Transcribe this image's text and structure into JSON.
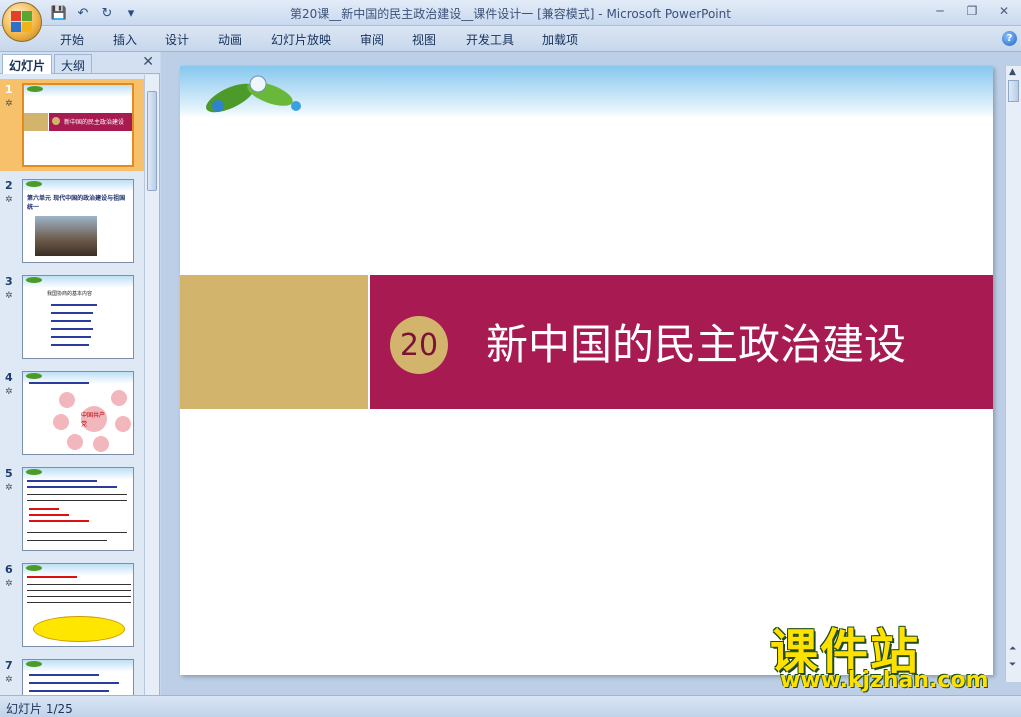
{
  "window": {
    "title": "第20课__新中国的民主政治建设__课件设计一 [兼容模式] - Microsoft PowerPoint"
  },
  "ribbon": {
    "tabs": [
      "开始",
      "插入",
      "设计",
      "动画",
      "幻灯片放映",
      "审阅",
      "视图",
      "开发工具",
      "加载项"
    ]
  },
  "left_pane": {
    "tabs": [
      "幻灯片",
      "大纲"
    ],
    "slides": [
      {
        "number": "1",
        "title": "新中国的民主政治建设"
      },
      {
        "number": "2",
        "title": "第六单元 现代中国的政治建设与祖国统一"
      },
      {
        "number": "3",
        "title": "我国协商的基本内容"
      },
      {
        "number": "4",
        "title": "中国共产党"
      },
      {
        "number": "5",
        "title": ""
      },
      {
        "number": "6",
        "title": ""
      },
      {
        "number": "7",
        "title": ""
      }
    ]
  },
  "slide": {
    "number_badge": "20",
    "title": "新中国的民主政治建设"
  },
  "watermark": {
    "brand": "课件站",
    "url": "www.kjzhan.com"
  },
  "status_bar": {
    "slide_indicator": "幻灯片 1/25"
  },
  "colors": {
    "band_maroon": "#a81a52",
    "band_gold": "#d3b46c",
    "watermark_yellow": "#ffe100"
  }
}
